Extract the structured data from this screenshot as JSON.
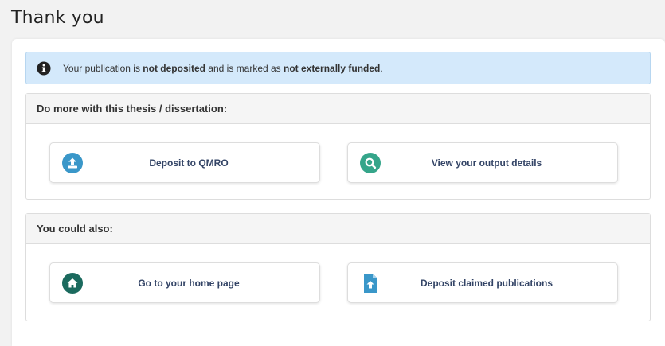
{
  "page": {
    "title": "Thank you"
  },
  "alert": {
    "icon": "info-circle-icon",
    "text_1": "Your publication is ",
    "bold_1": "not deposited",
    "text_2": " and is marked as ",
    "bold_2": "not externally funded",
    "text_3": "."
  },
  "panel_more": {
    "heading": "Do more with this thesis / dissertation:",
    "buttons": [
      {
        "label": "Deposit to QMRO",
        "icon": "upload-icon",
        "color": "#3a97c9"
      },
      {
        "label": "View your output details",
        "icon": "search-icon",
        "color": "#35a58a"
      }
    ]
  },
  "panel_also": {
    "heading": "You could also:",
    "buttons": [
      {
        "label": "Go to your home page",
        "icon": "home-icon",
        "color": "#1b6a5e"
      },
      {
        "label": "Deposit claimed publications",
        "icon": "file-upload-icon",
        "color": "#3a97c9"
      }
    ]
  }
}
